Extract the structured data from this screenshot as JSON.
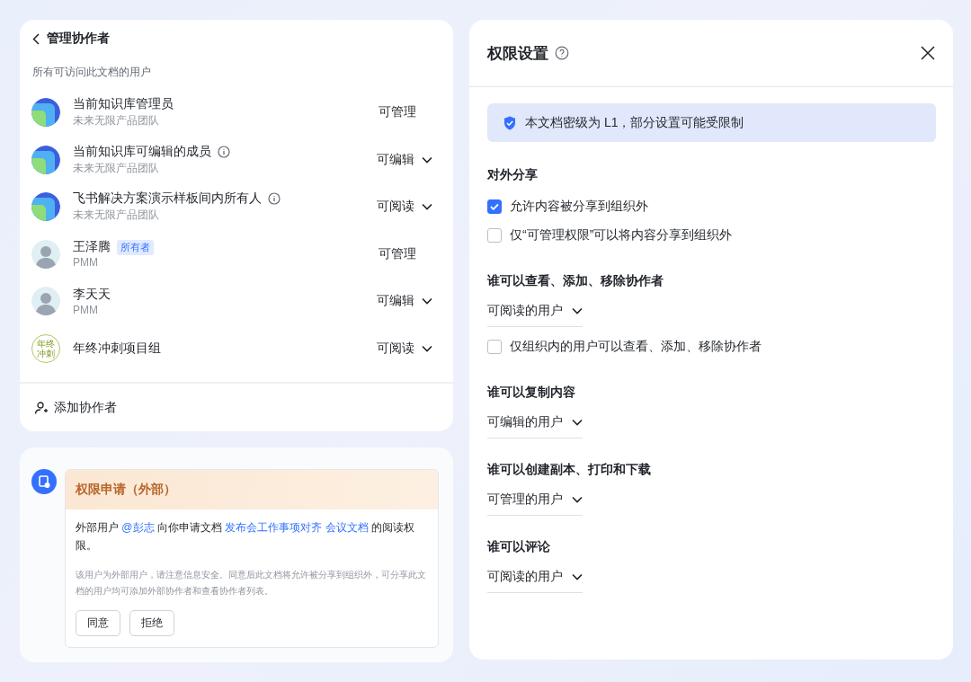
{
  "collaborators": {
    "title": "管理协作者",
    "subtitle": "所有可访问此文档的用户",
    "members": [
      {
        "kind": "group",
        "name": "当前知识库管理员",
        "info": false,
        "detail": "未来无限产品团队",
        "permission": "可管理",
        "dropdown": false
      },
      {
        "kind": "group",
        "name": "当前知识库可编辑的成员",
        "info": true,
        "detail": "未来无限产品团队",
        "permission": "可编辑",
        "dropdown": true
      },
      {
        "kind": "group",
        "name": "飞书解决方案演示样板间内所有人",
        "info": true,
        "detail": "未来无限产品团队",
        "permission": "可阅读",
        "dropdown": true
      },
      {
        "kind": "person",
        "name": "王泽腾",
        "info": false,
        "badge": "所有者",
        "detail": "PMM",
        "permission": "可管理",
        "dropdown": false
      },
      {
        "kind": "person",
        "name": "李天天",
        "info": false,
        "detail": "PMM",
        "permission": "可编辑",
        "dropdown": true
      },
      {
        "kind": "text",
        "avatar_text": "年终冲刺",
        "name": "年终冲刺项目组",
        "info": false,
        "permission": "可阅读",
        "dropdown": true
      }
    ],
    "add_label": "添加协作者"
  },
  "request": {
    "title": "权限申请（外部）",
    "message": [
      {
        "kind": "text",
        "text": "外部用户 "
      },
      {
        "kind": "link",
        "text": "@彭志"
      },
      {
        "kind": "text",
        "text": " 向你申请文档 "
      },
      {
        "kind": "link",
        "text": "发布会工作事项对齐 会议文档"
      },
      {
        "kind": "text",
        "text": " 的阅读权限。"
      }
    ],
    "note": "该用户为外部用户，请注意信息安全。同意后此文档将允许被分享到组织外，可分享此文档的用户均可添加外部协作者和查看协作者列表。",
    "buttons": [
      "同意",
      "拒绝"
    ]
  },
  "settings": {
    "title": "权限设置",
    "notice": "本文档密级为 L1，部分设置可能受限制",
    "sections": [
      {
        "title": "对外分享",
        "checkboxes": [
          {
            "label": "允许内容被分享到组织外",
            "checked": true
          },
          {
            "label": "仅“可管理权限”可以将内容分享到组织外",
            "checked": false
          }
        ]
      },
      {
        "title": "谁可以查看、添加、移除协作者",
        "dropdown": "可阅读的用户",
        "checkboxes": [
          {
            "label": "仅组织内的用户可以查看、添加、移除协作者",
            "checked": false
          }
        ]
      },
      {
        "title": "谁可以复制内容",
        "dropdown": "可编辑的用户"
      },
      {
        "title": "谁可以创建副本、打印和下载",
        "dropdown": "可管理的用户"
      },
      {
        "title": "谁可以评论",
        "dropdown": "可阅读的用户"
      }
    ]
  }
}
